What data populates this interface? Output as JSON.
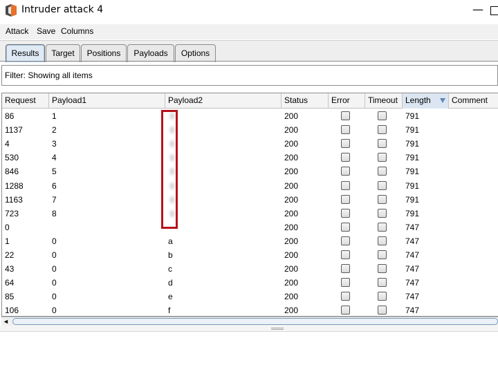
{
  "window": {
    "title": "Intruder attack 4",
    "minimize_glyph": "—"
  },
  "menu": [
    "Attack",
    "Save",
    "Columns"
  ],
  "tabs": [
    {
      "label": "Results",
      "active": true
    },
    {
      "label": "Target",
      "active": false
    },
    {
      "label": "Positions",
      "active": false
    },
    {
      "label": "Payloads",
      "active": false
    },
    {
      "label": "Options",
      "active": false
    }
  ],
  "filter": {
    "text": "Filter: Showing all items"
  },
  "table": {
    "columns": [
      "Request",
      "Payload1",
      "Payload2",
      "Status",
      "Error",
      "Timeout",
      "Length",
      "Comment"
    ],
    "sorted_column": "Length",
    "rows": [
      {
        "request": "86",
        "payload1": "1",
        "payload2": "",
        "payload2_redacted": true,
        "status": "200",
        "error": false,
        "timeout": false,
        "length": "791",
        "comment": ""
      },
      {
        "request": "1137",
        "payload1": "2",
        "payload2": "",
        "payload2_redacted": true,
        "status": "200",
        "error": false,
        "timeout": false,
        "length": "791",
        "comment": ""
      },
      {
        "request": "4",
        "payload1": "3",
        "payload2": "",
        "payload2_redacted": true,
        "status": "200",
        "error": false,
        "timeout": false,
        "length": "791",
        "comment": ""
      },
      {
        "request": "530",
        "payload1": "4",
        "payload2": "",
        "payload2_redacted": true,
        "status": "200",
        "error": false,
        "timeout": false,
        "length": "791",
        "comment": ""
      },
      {
        "request": "846",
        "payload1": "5",
        "payload2": "",
        "payload2_redacted": true,
        "status": "200",
        "error": false,
        "timeout": false,
        "length": "791",
        "comment": ""
      },
      {
        "request": "1288",
        "payload1": "6",
        "payload2": "",
        "payload2_redacted": true,
        "status": "200",
        "error": false,
        "timeout": false,
        "length": "791",
        "comment": ""
      },
      {
        "request": "1163",
        "payload1": "7",
        "payload2": "",
        "payload2_redacted": true,
        "status": "200",
        "error": false,
        "timeout": false,
        "length": "791",
        "comment": ""
      },
      {
        "request": "723",
        "payload1": "8",
        "payload2": "",
        "payload2_redacted": true,
        "status": "200",
        "error": false,
        "timeout": false,
        "length": "791",
        "comment": ""
      },
      {
        "request": "0",
        "payload1": "",
        "payload2": "",
        "payload2_redacted": false,
        "status": "200",
        "error": false,
        "timeout": false,
        "length": "747",
        "comment": ""
      },
      {
        "request": "1",
        "payload1": "0",
        "payload2": "a",
        "payload2_redacted": false,
        "status": "200",
        "error": false,
        "timeout": false,
        "length": "747",
        "comment": ""
      },
      {
        "request": "22",
        "payload1": "0",
        "payload2": "b",
        "payload2_redacted": false,
        "status": "200",
        "error": false,
        "timeout": false,
        "length": "747",
        "comment": ""
      },
      {
        "request": "43",
        "payload1": "0",
        "payload2": "c",
        "payload2_redacted": false,
        "status": "200",
        "error": false,
        "timeout": false,
        "length": "747",
        "comment": ""
      },
      {
        "request": "64",
        "payload1": "0",
        "payload2": "d",
        "payload2_redacted": false,
        "status": "200",
        "error": false,
        "timeout": false,
        "length": "747",
        "comment": ""
      },
      {
        "request": "85",
        "payload1": "0",
        "payload2": "e",
        "payload2_redacted": false,
        "status": "200",
        "error": false,
        "timeout": false,
        "length": "747",
        "comment": ""
      },
      {
        "request": "106",
        "payload1": "0",
        "payload2": "f",
        "payload2_redacted": false,
        "status": "200",
        "error": false,
        "timeout": false,
        "length": "747",
        "comment": ""
      }
    ]
  },
  "colors": {
    "highlight_border": "#b5121b",
    "sorted_header": "#dbe6f2",
    "sort_arrow": "#5f86b5"
  },
  "icons": {
    "app": "burp-suite-icon",
    "scroll_left": "◄"
  }
}
